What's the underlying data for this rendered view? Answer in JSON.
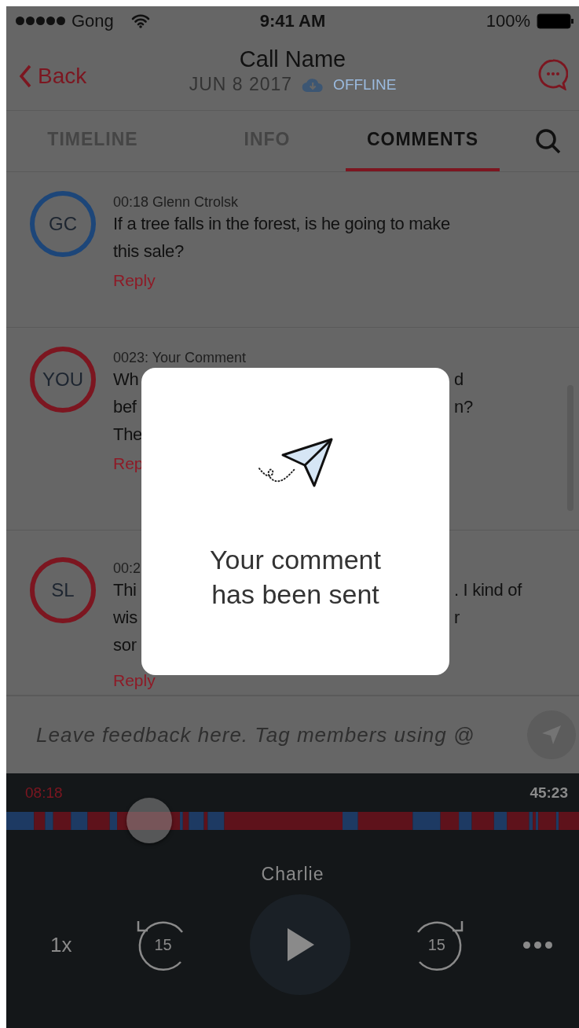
{
  "status_bar": {
    "carrier": "Gong",
    "time": "9:41 AM",
    "battery": "100%"
  },
  "nav": {
    "back": "Back",
    "title": "Call Name",
    "date": "JUN 8 2017",
    "offline": "OFFLINE"
  },
  "tabs": [
    {
      "label": "TIMELINE",
      "selected": false
    },
    {
      "label": "INFO",
      "selected": false
    },
    {
      "label": "COMMENTS",
      "selected": true
    }
  ],
  "comments": [
    {
      "initials": "GC",
      "color": "#1d4679",
      "meta": "00:18  Glenn Ctrolsk",
      "lines": [
        {
          "left": "If a tree falls in the forest, is he going to make"
        },
        {
          "left": "this sale?"
        }
      ],
      "reply": "Reply"
    },
    {
      "initials": "YOU",
      "color": "#7c1620",
      "meta": "0023:  Your Comment",
      "lines": [
        {
          "left": "Wh",
          "right": "d"
        },
        {
          "left": "bef",
          "right": "n?"
        },
        {
          "left": "The"
        }
      ],
      "reply": "Rep"
    },
    {
      "initials": "SL",
      "color": "#7c1620",
      "meta": "00:2",
      "lines": [
        {
          "left": "Thi",
          "right": ". I kind of"
        },
        {
          "left": "wis",
          "right": "r"
        },
        {
          "left": "sor"
        }
      ],
      "reply": "Reply"
    }
  ],
  "composer": {
    "placeholder": "Leave feedback here. Tag members using @"
  },
  "player": {
    "elapsed": "08:18",
    "total": "45:23",
    "level": 0.25,
    "speaker": "Charlie",
    "speed": "1x",
    "rewind": "15",
    "forward": "15"
  },
  "modal": {
    "message": "Your comment\nhas been sent"
  }
}
